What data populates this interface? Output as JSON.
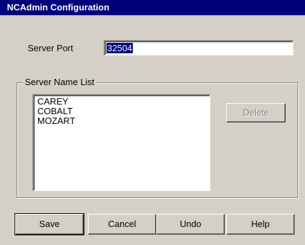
{
  "window": {
    "title": "NCAdmin Configuration"
  },
  "server_port": {
    "label": "Server Port",
    "value": "32504"
  },
  "server_name_list": {
    "legend": "Server Name List",
    "items": [
      "CAREY",
      "COBALT",
      "MOZART"
    ],
    "delete_label": "Delete"
  },
  "buttons": {
    "save": "Save",
    "cancel": "Cancel",
    "undo": "Undo",
    "help": "Help"
  }
}
